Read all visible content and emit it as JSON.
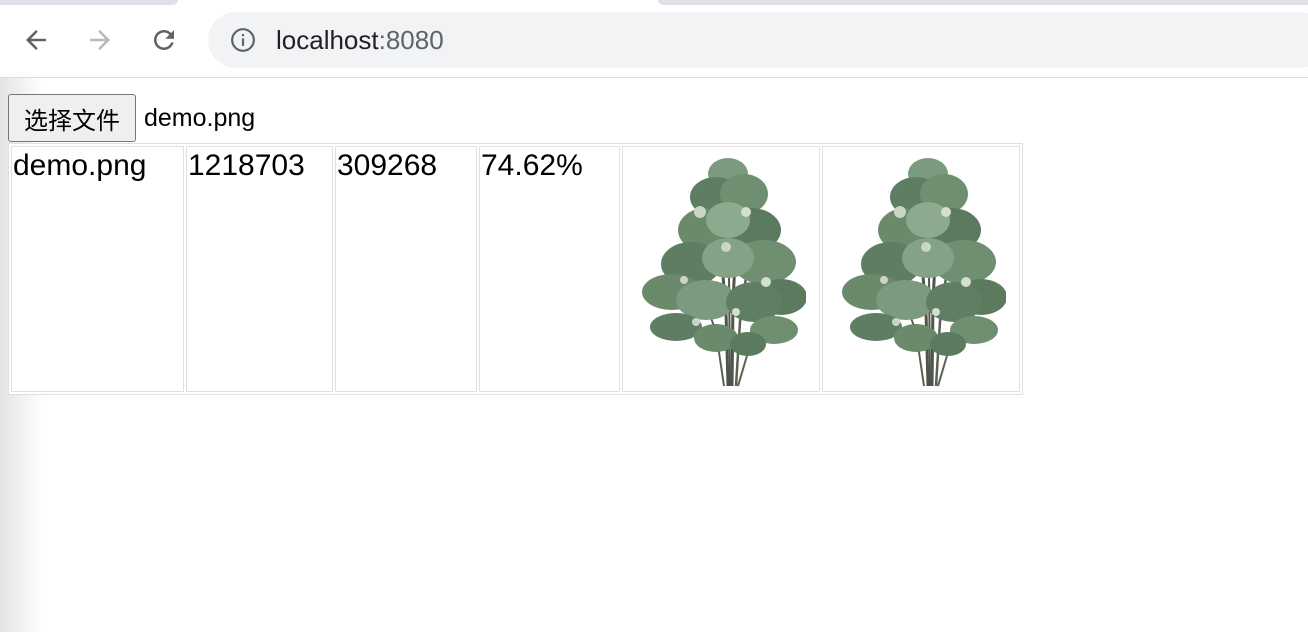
{
  "browser": {
    "url_host": "localhost",
    "url_port": ":8080",
    "icons": {
      "back": "arrow-left-icon",
      "forward": "arrow-right-icon",
      "reload": "reload-icon",
      "site_info": "info-circle-icon"
    }
  },
  "page": {
    "file_input": {
      "button_label": "选择文件",
      "selected_file": "demo.png"
    },
    "results": {
      "rows": [
        {
          "name": "demo.png",
          "original_size": "1218703",
          "compressed_size": "309268",
          "ratio": "74.62%",
          "images": [
            "tree-image-original",
            "tree-image-compressed"
          ]
        }
      ]
    }
  },
  "colors": {
    "omnibox_bg": "#f1f3f4",
    "icon_dark": "#5f6368",
    "icon_disabled": "#b6b8bb",
    "table_border": "#e0e0e0",
    "foliage": "#5f7d62",
    "trunk": "#4e5549"
  }
}
